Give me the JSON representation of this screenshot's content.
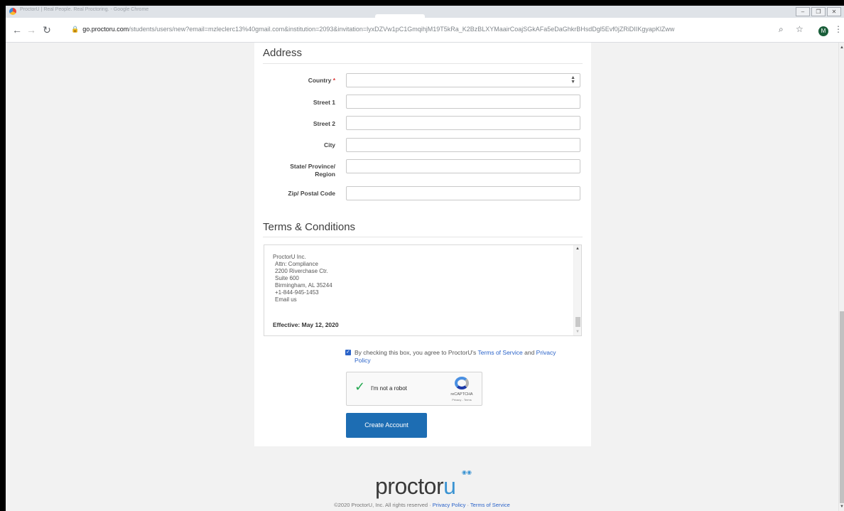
{
  "browser": {
    "tab_title": "ProctorU | Real People. Real Proctoring. - Google Chrome",
    "url_host": "go.proctoru.com",
    "url_path": "/students/users/new?email=mzleclerc13%40gmail.com&institution=2093&invitation=lyxDZVw1pC1GmqihjM19T5kRa_K2BzBLXYMaairCoajSGkAFa5eDaGhkrBHsdDgl5Evf0jZRiDIIKgyapKlZww",
    "profile_initial": "M"
  },
  "address": {
    "title": "Address",
    "country_label": "Country",
    "required_marker": "*",
    "street1_label": "Street 1",
    "street2_label": "Street 2",
    "city_label": "City",
    "state_label": "State/ Province/ Region",
    "zip_label": "Zip/ Postal Code"
  },
  "terms": {
    "title": "Terms & Conditions",
    "lines": [
      "ProctorU Inc.",
      "Attn: Compliance",
      "2200 Riverchase Ctr.",
      "Suite 600",
      "Birmingham, AL 35244",
      "+1-844-945-1453",
      "Email us"
    ],
    "effective": "Effective: May 12, 2020"
  },
  "agreement": {
    "prefix": "By checking this box, you agree to ProctorU's ",
    "tos_link": "Terms of Service",
    "and": " and ",
    "privacy_link": "Privacy Policy",
    "checked": true
  },
  "captcha": {
    "label": "I'm not a robot",
    "brand": "reCAPTCHA",
    "links": "Privacy - Terms"
  },
  "submit_label": "Create Account",
  "footer": {
    "logo_text": "proctor",
    "logo_u": "u",
    "copyright": "©2020 ProctorU, Inc. All rights reserved · ",
    "privacy": "Privacy Policy",
    "sep": " · ",
    "tos": "Terms of Service"
  }
}
